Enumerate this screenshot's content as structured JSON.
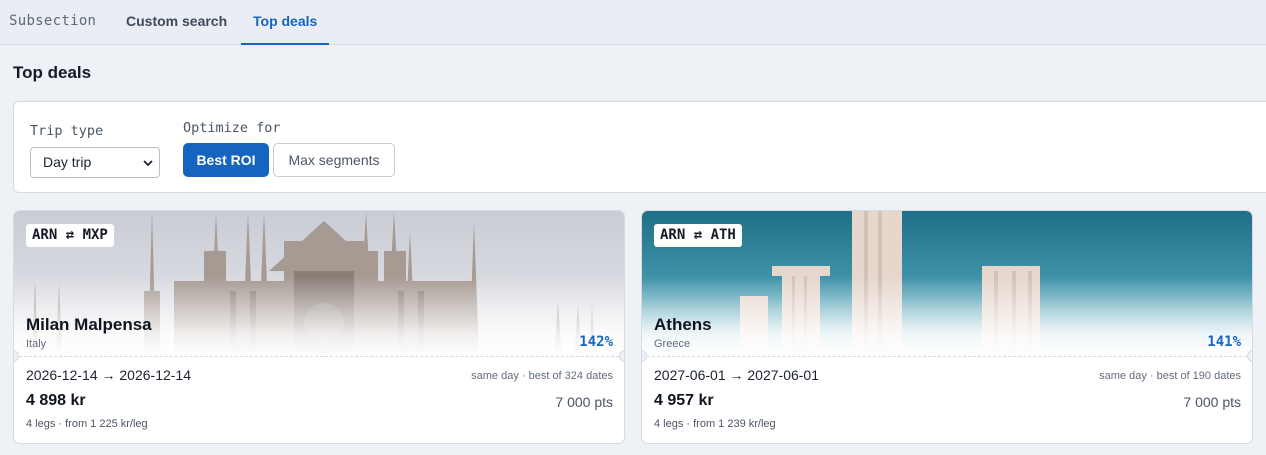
{
  "tabs": {
    "subsection": "Subsection",
    "custom_search": "Custom search",
    "top_deals": "Top deals",
    "active": "top_deals"
  },
  "page": {
    "title": "Top deals"
  },
  "filters": {
    "trip_type_label": "Trip type",
    "trip_type_value": "Day trip",
    "optimize_label": "Optimize for",
    "optimize_options": [
      "Best ROI",
      "Max segments"
    ],
    "optimize_selected": "Best ROI"
  },
  "deals": [
    {
      "route": "ARN ⇄ MXP",
      "city": "Milan Malpensa",
      "country": "Italy",
      "roi": "142%",
      "dates": "2026-12-14 → 2026-12-14",
      "best": "same day · best of 324 dates",
      "price": "4 898 kr",
      "points": "7 000 pts",
      "legs": "4 legs · from 1 225 kr/leg",
      "image": "milan-cathedral"
    },
    {
      "route": "ARN ⇄ ATH",
      "city": "Athens",
      "country": "Greece",
      "roi": "141%",
      "dates": "2027-06-01 → 2027-06-01",
      "best": "same day · best of 190 dates",
      "price": "4 957 kr",
      "points": "7 000 pts",
      "legs": "4 legs · from 1 239 kr/leg",
      "image": "athens-columns"
    }
  ],
  "colors": {
    "accent": "#1565c0",
    "background": "#eef1f6"
  }
}
